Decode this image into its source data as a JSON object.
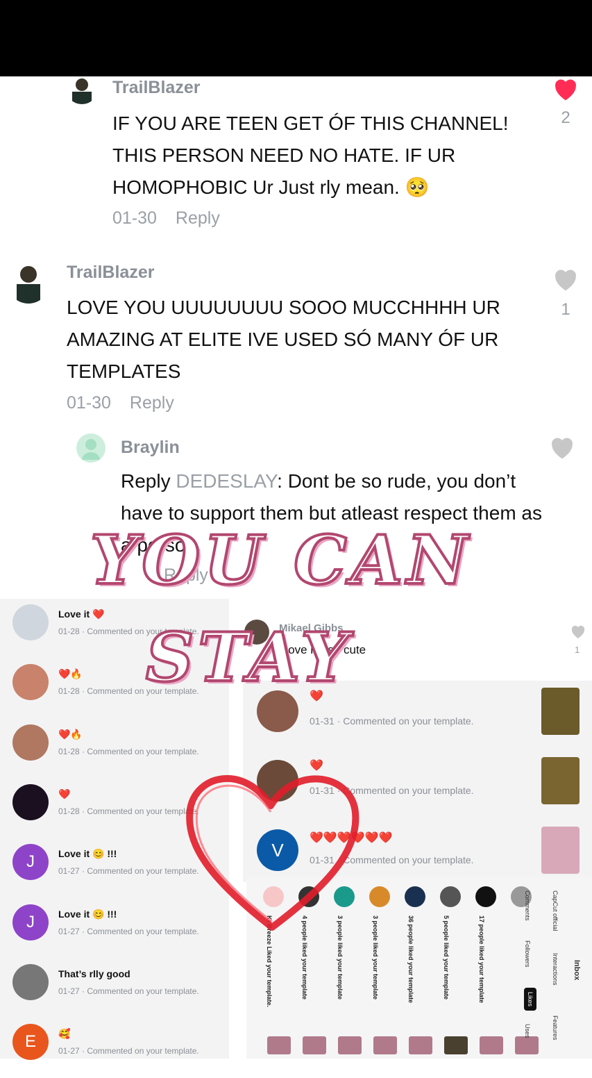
{
  "comments": [
    {
      "user": "TrailBlazer",
      "text": "IF YOU ARE TEEN GET ÓF THIS CHANNEL! THIS PERSON NEED NO HATE. IF UR HOMOPHOBIC Ur Just rly mean. 🥺",
      "date": "01-30",
      "reply": "Reply",
      "likes": "2"
    },
    {
      "user": "TrailBlazer",
      "text": "LOVE YOU UUUUUUUU SOOO MUCCHHHH UR AMAZING AT ELITE IVE USED SÓ MANY ÓF UR TEMPLATES",
      "date": "01-30",
      "reply": "Reply",
      "likes": "1"
    },
    {
      "user": "Braylin",
      "reply_prefix": "Reply",
      "reply_to": "DEDESLAY",
      "text": ": Dont be so rude, you don’t have to support them but atleast respect them as a person.",
      "reply": "Reply"
    }
  ],
  "overlay": {
    "line1": "YOU CAN",
    "line2": "STAY"
  },
  "notifications": [
    {
      "title": "Love it ❤️",
      "sub": "01-28 · Commented on your template.",
      "avatar": "#cfd6dd"
    },
    {
      "title": "❤️🔥",
      "sub": "01-28 · Commented on your template.",
      "avatar": "#c9826b"
    },
    {
      "title": "❤️🔥",
      "sub": "01-28 · Commented on your template.",
      "avatar": "#b07761"
    },
    {
      "title": "❤️",
      "sub": "01-28 · Commented on your template.",
      "avatar": "#1a1020"
    },
    {
      "title": "Love it 😊 !!!",
      "sub": "01-27 · Commented on your template.",
      "avatar": "#8e44c9",
      "letter": "J"
    },
    {
      "title": "Love it 😊 !!!",
      "sub": "01-27 · Commented on your template.",
      "avatar": "#8e44c9",
      "letter": "J"
    },
    {
      "title": "That’s rlly good",
      "sub": "01-27 · Commented on your template.",
      "avatar": "#777"
    },
    {
      "title": "🥰",
      "sub": "01-27 · Commented on your template.",
      "avatar": "#e8561e",
      "letter": "E"
    }
  ],
  "mikael": {
    "name": "Mikael Gibbs",
    "text": "I love it's so cute",
    "likes": "1"
  },
  "mid_items": [
    {
      "text": "❤️",
      "sub": "01-31 · Commented on your template.",
      "avatar": "#8a5a4a"
    },
    {
      "text": "❤️",
      "sub": "01-31 · Commented on your template.",
      "avatar": "#6b4a3a"
    },
    {
      "text": "❤️❤️❤️❤️❤️❤️",
      "sub": "01-31 · Commented on your template.",
      "avatar": "#0b5aa8",
      "letter": "V"
    }
  ],
  "rotated": {
    "columns": [
      {
        "text": "Kr Breeze Liked your template.",
        "avatar": "#f7c6c6"
      },
      {
        "text": "4 people liked your template",
        "avatar": "#333"
      },
      {
        "text": "3 people liked your template",
        "avatar": "#1a9a8a"
      },
      {
        "text": "3 people liked your template",
        "avatar": "#d88a2a"
      },
      {
        "text": "36 people liked your template",
        "avatar": "#1a3050"
      },
      {
        "text": "5 people liked your template",
        "avatar": "#555"
      },
      {
        "text": "17 people liked your template",
        "avatar": "#111"
      },
      {
        "text": "",
        "avatar": "#999"
      }
    ],
    "tabs": {
      "comments": "Comments",
      "followers": "Followers",
      "likes": "Likes",
      "uses": "Uses"
    },
    "side": {
      "inbox": "Inbox",
      "interactions": "Interactions",
      "capcut": "CapCut official",
      "features": "Features"
    }
  },
  "colors": {
    "heart_active": "#ff2d55",
    "heart_inactive": "#c7c7c7",
    "overlay_stroke": "#b2476f"
  }
}
